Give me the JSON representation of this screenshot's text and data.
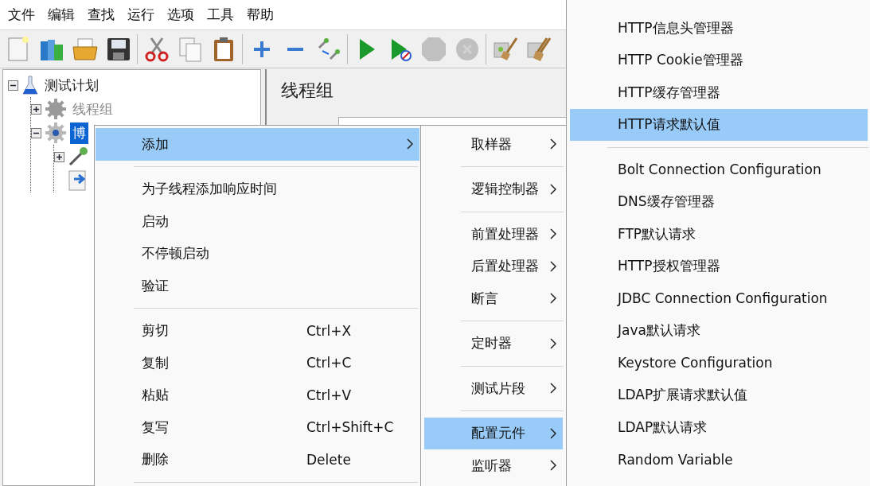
{
  "menu_bar": [
    "文件",
    "编辑",
    "查找",
    "运行",
    "选项",
    "工具",
    "帮助"
  ],
  "toolbar": [
    {
      "kind": "new",
      "disabled": false
    },
    {
      "kind": "open",
      "disabled": false
    },
    {
      "kind": "folder",
      "disabled": false
    },
    {
      "kind": "save",
      "disabled": false
    },
    {
      "kind": "separator"
    },
    {
      "kind": "cut",
      "disabled": false
    },
    {
      "kind": "copy",
      "disabled": false
    },
    {
      "kind": "paste",
      "disabled": false
    },
    {
      "kind": "separator"
    },
    {
      "kind": "expand",
      "disabled": false
    },
    {
      "kind": "collapse",
      "disabled": false
    },
    {
      "kind": "toggle",
      "disabled": false
    },
    {
      "kind": "separator"
    },
    {
      "kind": "start",
      "disabled": false
    },
    {
      "kind": "start_no_pause",
      "disabled": false
    },
    {
      "kind": "stop",
      "disabled": true
    },
    {
      "kind": "shutdown",
      "disabled": true
    },
    {
      "kind": "separator"
    },
    {
      "kind": "clear",
      "disabled": false
    },
    {
      "kind": "clear_all",
      "disabled": false
    }
  ],
  "tree": [
    {
      "kind": "plan",
      "label": "测试计划",
      "expanded": true,
      "selected": false,
      "disabled": false,
      "children": [
        {
          "kind": "thread_group",
          "label": "线程组",
          "expanded": false,
          "selected": false,
          "disabled": true
        },
        {
          "kind": "thread_group",
          "label": "博",
          "expanded": true,
          "selected": true,
          "disabled": false,
          "children": [
            {
              "kind": "dropper",
              "expanded": false
            },
            {
              "kind": "sampler"
            }
          ]
        }
      ]
    }
  ],
  "panel": {
    "title": "线程组"
  },
  "context_menu": [
    {
      "kind": "item",
      "label": "添加",
      "submenu": true,
      "selected": true
    },
    {
      "kind": "separator"
    },
    {
      "kind": "item",
      "label": "为子线程添加响应时间",
      "submenu": false,
      "selected": false
    },
    {
      "kind": "item",
      "label": "启动",
      "submenu": false,
      "selected": false
    },
    {
      "kind": "item",
      "label": "不停顿启动",
      "submenu": false,
      "selected": false
    },
    {
      "kind": "item",
      "label": "验证",
      "submenu": false,
      "selected": false
    },
    {
      "kind": "separator"
    },
    {
      "kind": "item",
      "label": "剪切",
      "shortcut": "Ctrl+X",
      "submenu": false,
      "selected": false
    },
    {
      "kind": "item",
      "label": "复制",
      "shortcut": "Ctrl+C",
      "submenu": false,
      "selected": false
    },
    {
      "kind": "item",
      "label": "粘贴",
      "shortcut": "Ctrl+V",
      "submenu": false,
      "selected": false
    },
    {
      "kind": "item",
      "label": "复写",
      "shortcut": "Ctrl+Shift+C",
      "submenu": false,
      "selected": false
    },
    {
      "kind": "item",
      "label": "删除",
      "shortcut": "Delete",
      "submenu": false,
      "selected": false
    },
    {
      "kind": "separator"
    }
  ],
  "add_submenu": [
    {
      "kind": "item",
      "label": "取样器",
      "submenu": true,
      "selected": false
    },
    {
      "kind": "separator"
    },
    {
      "kind": "item",
      "label": "逻辑控制器",
      "submenu": true,
      "selected": false
    },
    {
      "kind": "separator"
    },
    {
      "kind": "item",
      "label": "前置处理器",
      "submenu": true,
      "selected": false
    },
    {
      "kind": "item",
      "label": "后置处理器",
      "submenu": true,
      "selected": false
    },
    {
      "kind": "item",
      "label": "断言",
      "submenu": true,
      "selected": false
    },
    {
      "kind": "separator"
    },
    {
      "kind": "item",
      "label": "定时器",
      "submenu": true,
      "selected": false
    },
    {
      "kind": "separator"
    },
    {
      "kind": "item",
      "label": "测试片段",
      "submenu": true,
      "selected": false
    },
    {
      "kind": "separator"
    },
    {
      "kind": "item",
      "label": "配置元件",
      "submenu": true,
      "selected": true
    },
    {
      "kind": "item",
      "label": "监听器",
      "submenu": true,
      "selected": false
    }
  ],
  "config_submenu": [
    {
      "kind": "item",
      "label": "HTTP信息头管理器",
      "submenu": false,
      "selected": false
    },
    {
      "kind": "item",
      "label": "HTTP Cookie管理器",
      "submenu": false,
      "selected": false
    },
    {
      "kind": "item",
      "label": "HTTP缓存管理器",
      "submenu": false,
      "selected": false
    },
    {
      "kind": "item",
      "label": "HTTP请求默认值",
      "submenu": false,
      "selected": true
    },
    {
      "kind": "separator"
    },
    {
      "kind": "item",
      "label": "Bolt Connection Configuration",
      "submenu": false,
      "selected": false
    },
    {
      "kind": "item",
      "label": "DNS缓存管理器",
      "submenu": false,
      "selected": false
    },
    {
      "kind": "item",
      "label": "FTP默认请求",
      "submenu": false,
      "selected": false
    },
    {
      "kind": "item",
      "label": "HTTP授权管理器",
      "submenu": false,
      "selected": false
    },
    {
      "kind": "item",
      "label": "JDBC Connection Configuration",
      "submenu": false,
      "selected": false
    },
    {
      "kind": "item",
      "label": "Java默认请求",
      "submenu": false,
      "selected": false
    },
    {
      "kind": "item",
      "label": "Keystore Configuration",
      "submenu": false,
      "selected": false
    },
    {
      "kind": "item",
      "label": "LDAP扩展请求默认值",
      "submenu": false,
      "selected": false
    },
    {
      "kind": "item",
      "label": "LDAP默认请求",
      "submenu": false,
      "selected": false
    },
    {
      "kind": "item",
      "label": "Random Variable",
      "submenu": false,
      "selected": false
    }
  ]
}
